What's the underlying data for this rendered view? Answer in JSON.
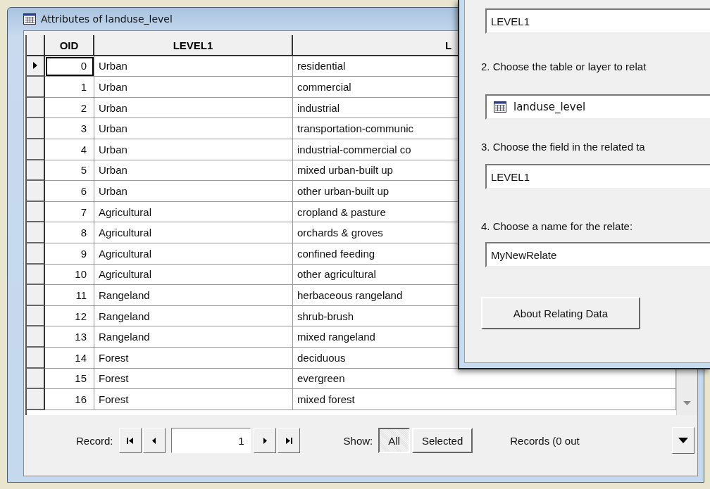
{
  "window": {
    "title": "Attributes of landuse_level"
  },
  "table": {
    "columns": [
      "OID",
      "LEVEL1",
      "L"
    ],
    "rows": [
      {
        "current": true,
        "cells": [
          "0",
          "Urban",
          "residential"
        ]
      },
      {
        "current": false,
        "cells": [
          "1",
          "Urban",
          "commercial"
        ]
      },
      {
        "current": false,
        "cells": [
          "2",
          "Urban",
          "industrial"
        ]
      },
      {
        "current": false,
        "cells": [
          "3",
          "Urban",
          "transportation-communic"
        ]
      },
      {
        "current": false,
        "cells": [
          "4",
          "Urban",
          "industrial-commercial co"
        ]
      },
      {
        "current": false,
        "cells": [
          "5",
          "Urban",
          "mixed urban-built up"
        ]
      },
      {
        "current": false,
        "cells": [
          "6",
          "Urban",
          "other urban-built up"
        ]
      },
      {
        "current": false,
        "cells": [
          "7",
          "Agricultural",
          "cropland & pasture"
        ]
      },
      {
        "current": false,
        "cells": [
          "8",
          "Agricultural",
          "orchards & groves"
        ]
      },
      {
        "current": false,
        "cells": [
          "9",
          "Agricultural",
          "confined feeding"
        ]
      },
      {
        "current": false,
        "cells": [
          "10",
          "Agricultural",
          "other agricultural"
        ]
      },
      {
        "current": false,
        "cells": [
          "11",
          "Rangeland",
          "herbaceous rangeland"
        ]
      },
      {
        "current": false,
        "cells": [
          "12",
          "Rangeland",
          "shrub-brush"
        ]
      },
      {
        "current": false,
        "cells": [
          "13",
          "Rangeland",
          "mixed rangeland"
        ]
      },
      {
        "current": false,
        "cells": [
          "14",
          "Forest",
          "deciduous"
        ]
      },
      {
        "current": false,
        "cells": [
          "15",
          "Forest",
          "evergreen"
        ]
      },
      {
        "current": false,
        "cells": [
          "16",
          "Forest",
          "mixed forest"
        ]
      }
    ]
  },
  "record_bar": {
    "label": "Record:",
    "value": "1"
  },
  "show": {
    "label": "Show:",
    "options": [
      {
        "label": "All",
        "selected": true
      },
      {
        "label": "Selected",
        "selected": false
      }
    ]
  },
  "records_text": "Records (0 out",
  "dialog": {
    "items": [
      {
        "kind": "field",
        "value": "LEVEL1"
      },
      {
        "kind": "label",
        "text": "2. Choose the table or layer to relat"
      },
      {
        "kind": "table-field",
        "value": "landuse_level"
      },
      {
        "kind": "label",
        "text": "3. Choose the field in the related ta"
      },
      {
        "kind": "field",
        "value": "LEVEL1"
      },
      {
        "kind": "label",
        "text": "4. Choose a name for the relate:"
      },
      {
        "kind": "field",
        "value": "MyNewRelate"
      },
      {
        "kind": "button",
        "label": "About Relating Data"
      }
    ]
  }
}
